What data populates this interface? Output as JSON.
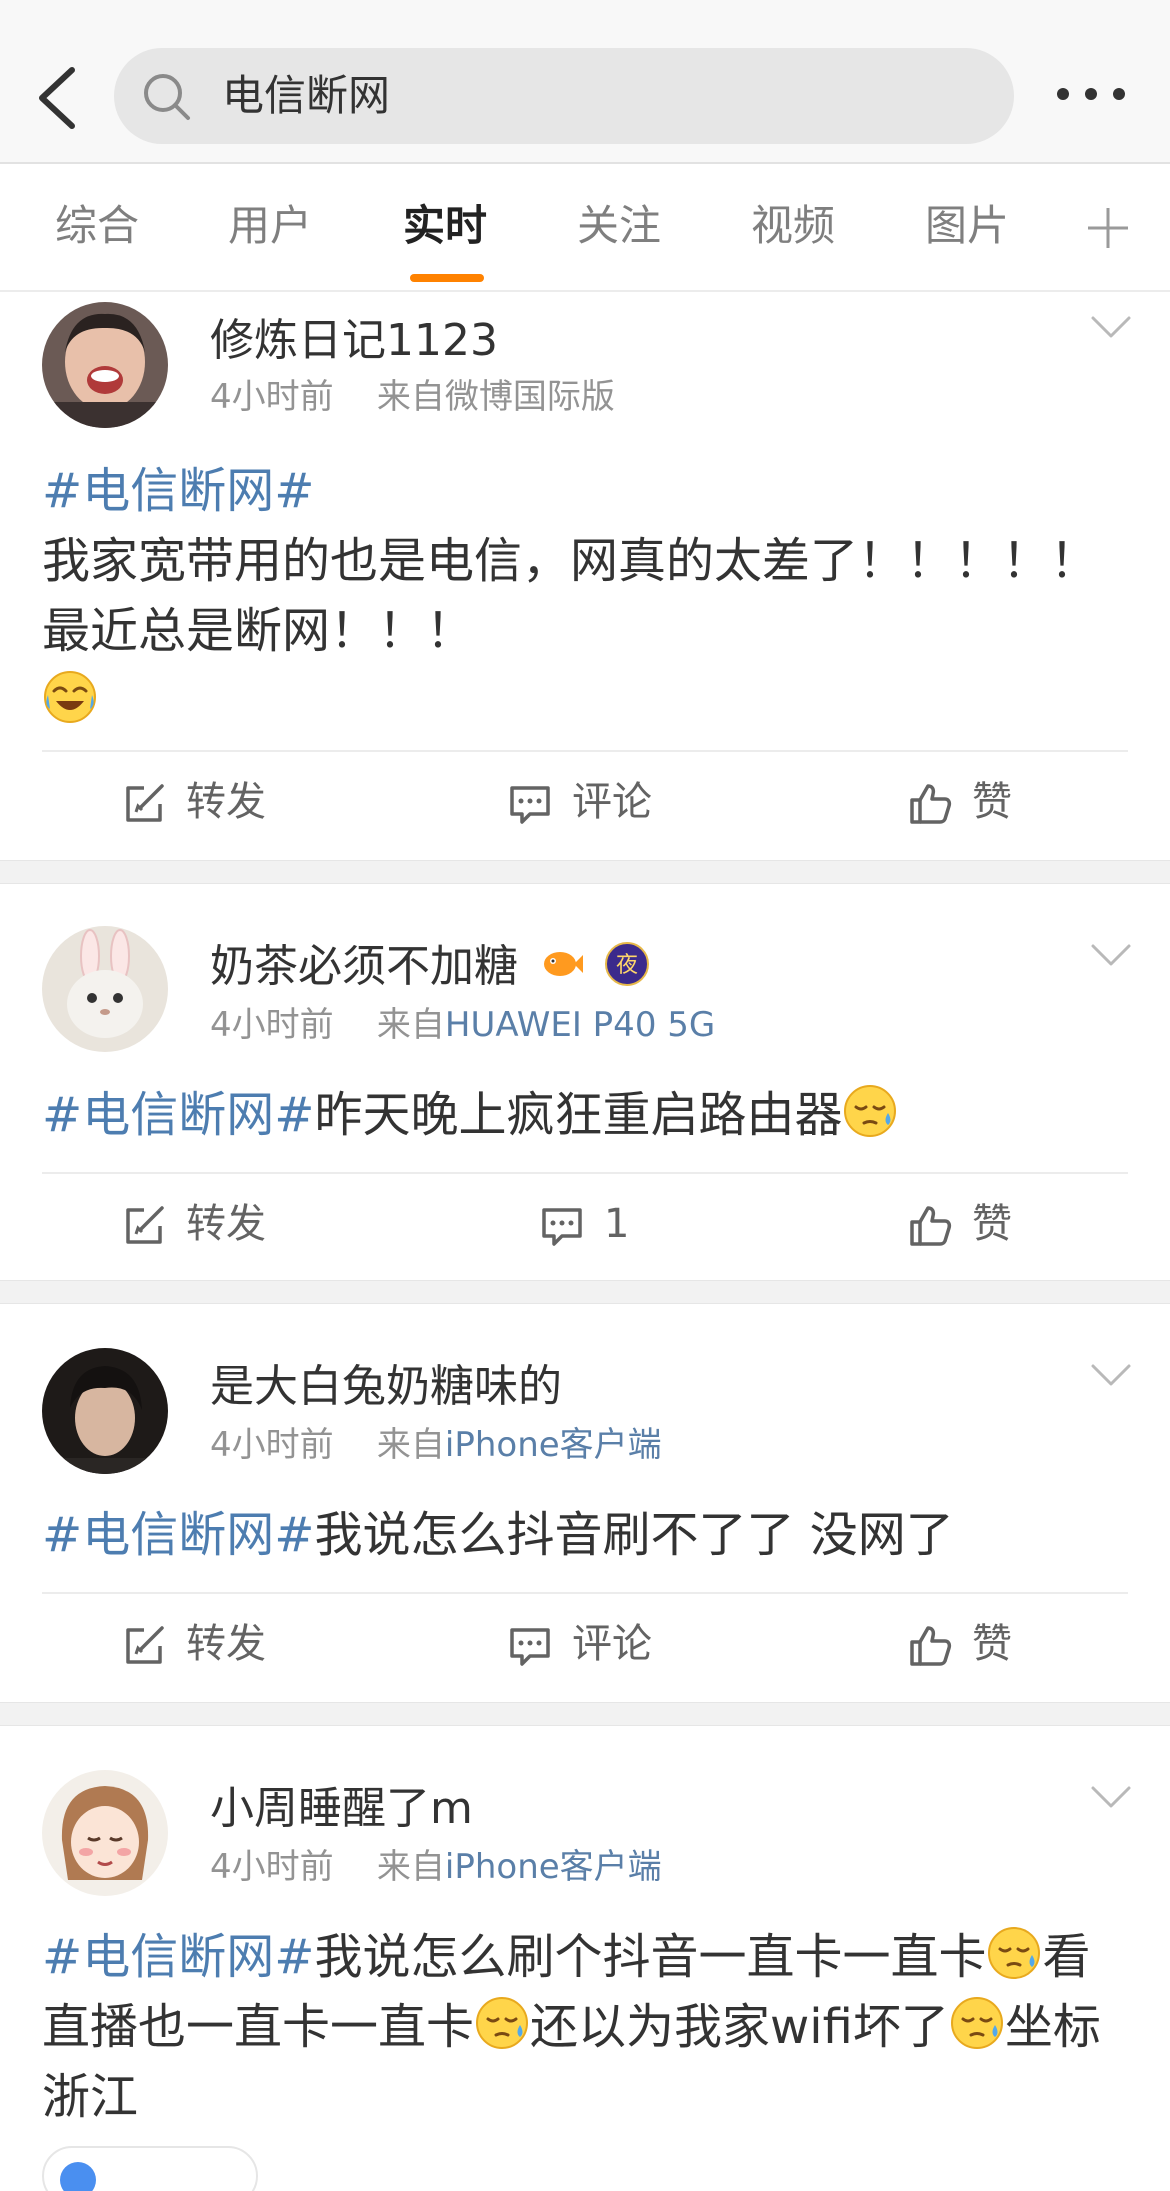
{
  "search": {
    "query": "电信断网"
  },
  "tabs": [
    {
      "label": "综合"
    },
    {
      "label": "用户"
    },
    {
      "label": "实时"
    },
    {
      "label": "关注"
    },
    {
      "label": "视频"
    },
    {
      "label": "图片"
    }
  ],
  "active_tab": "实时",
  "colors": {
    "accent": "#ff8200",
    "hashtag": "#4d7db0",
    "meta_gray": "#939393"
  },
  "posts": [
    {
      "username": "修炼日记1123",
      "time": "4小时前",
      "source_prefix": "来自",
      "source": "微博国际版",
      "hashtag": "#电信断网#",
      "text": "我家宽带用的也是电信，网真的太差了！！！！！最近总是断网！！！",
      "repost_label": "转发",
      "comment_label": "评论",
      "like_label": "赞"
    },
    {
      "username": "奶茶必须不加糖",
      "time": "4小时前",
      "source_prefix": "来自",
      "source": "HUAWEI P40 5G",
      "hashtag": "#电信断网#",
      "text": "昨天晚上疯狂重启路由器",
      "repost_label": "转发",
      "comment_label": "1",
      "like_label": "赞"
    },
    {
      "username": "是大白兔奶糖味的",
      "time": "4小时前",
      "source_prefix": "来自",
      "source": "iPhone客户端",
      "hashtag": "#电信断网#",
      "text": "我说怎么抖音刷不了了 没网了",
      "repost_label": "转发",
      "comment_label": "评论",
      "like_label": "赞"
    },
    {
      "username": "小周睡醒了m",
      "time": "4小时前",
      "source_prefix": "来自",
      "source": "iPhone客户端",
      "hashtag": "#电信断网#",
      "text_part1": "我说怎么刷个抖音一直卡一直卡",
      "text_part2": "看直播也一直卡一直卡",
      "text_part3": "还以为我家wifi坏了",
      "text_part4": "坐标浙江"
    }
  ],
  "badge_night_char": "夜"
}
